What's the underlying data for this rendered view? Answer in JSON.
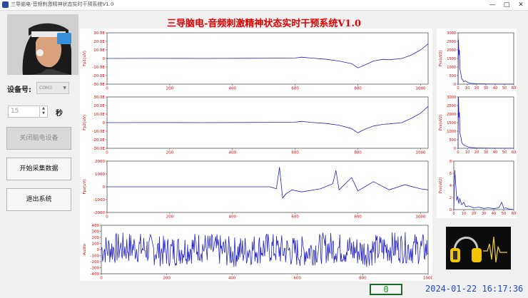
{
  "window": {
    "title": "三导脑电-音频刺激精神状态实时干预系统V1.0",
    "controls": [
      "—",
      "□",
      "✕"
    ]
  },
  "app": {
    "title": "三导脑电-音频刺激精神状态实时干预系统V1.0"
  },
  "sidebar": {
    "device_label": "设备号:",
    "device_value": "COM3",
    "seconds_value": "15",
    "seconds_unit": "秒",
    "buttons": [
      {
        "label": "关闭脑电设备",
        "enabled": false
      },
      {
        "label": "开始采集数据",
        "enabled": true
      },
      {
        "label": "退出系统",
        "enabled": true
      }
    ]
  },
  "status": {
    "counter": "0",
    "datetime": "2024-01-22 16:17:36"
  },
  "colors": {
    "trace": "#2323c8",
    "title": "#e00000",
    "clock": "#1d4bd0",
    "counter": "#1aa41a"
  },
  "chart_data": [
    {
      "type": "line",
      "ylabel": "Fp1(uV)",
      "x_ticks": [
        "0",
        "200",
        "400",
        "600",
        "800",
        "1000"
      ],
      "y_ticks": [
        "-30.0E",
        "-20.0E",
        "-10.0E",
        "0",
        "10.0E",
        "20.0E",
        "30.0E"
      ],
      "xlim": [
        0,
        1024
      ],
      "ylim": [
        -30,
        30
      ],
      "x": [
        0,
        150,
        300,
        450,
        600,
        620,
        650,
        700,
        740,
        780,
        800,
        820,
        850,
        880,
        900,
        940,
        970,
        1000,
        1024
      ],
      "y": [
        0,
        0.1,
        0,
        0.2,
        0.5,
        1.5,
        0.5,
        -1,
        -3,
        -6,
        -11,
        -8,
        -3,
        -1,
        -1.5,
        0,
        4,
        10,
        17
      ]
    },
    {
      "type": "line",
      "ylabel": "Fp2(uV)",
      "x_ticks": [
        "0",
        "200",
        "400",
        "600",
        "800",
        "1000"
      ],
      "y_ticks": [
        "-30.0E",
        "-20.0E",
        "-10.0E",
        "0",
        "10.0E",
        "20.0E",
        "30.0E"
      ],
      "xlim": [
        0,
        1024
      ],
      "ylim": [
        -30,
        30
      ],
      "x": [
        0,
        150,
        300,
        450,
        600,
        620,
        650,
        700,
        740,
        780,
        800,
        820,
        850,
        880,
        900,
        940,
        970,
        1000,
        1024
      ],
      "y": [
        0,
        0.1,
        0,
        0.2,
        0.5,
        1.5,
        0.3,
        -1,
        -3,
        -7,
        -12,
        -8,
        -4,
        -2,
        -1.5,
        0,
        5,
        11,
        19
      ]
    },
    {
      "type": "line",
      "ylabel": "Fpz(uV)",
      "x_ticks": [
        "0",
        "200",
        "400",
        "600",
        "800",
        "1000"
      ],
      "y_ticks": [
        "-2000",
        "-1000",
        "0",
        "1000",
        "2000"
      ],
      "xlim": [
        0,
        1024
      ],
      "ylim": [
        -2500,
        2500
      ],
      "x": [
        0,
        200,
        400,
        520,
        540,
        550,
        560,
        570,
        590,
        620,
        680,
        720,
        730,
        740,
        780,
        800,
        850,
        900,
        950,
        1000,
        1024
      ],
      "y": [
        0,
        0,
        0,
        0,
        -200,
        1900,
        -1100,
        -700,
        -300,
        -500,
        -200,
        300,
        1600,
        -300,
        900,
        -400,
        500,
        -300,
        200,
        -200,
        -300
      ]
    },
    {
      "type": "line",
      "ylabel": "Audio",
      "x_ticks": [
        "0",
        "200",
        "400",
        "600",
        "800",
        "1000"
      ],
      "y_ticks": [
        "-400",
        "-300",
        "-200",
        "-100",
        "0",
        "100",
        "200",
        "300",
        "400"
      ],
      "xlim": [
        0,
        1000
      ],
      "ylim": [
        -400,
        400
      ],
      "x": [
        0,
        100,
        200,
        300,
        400,
        500,
        600,
        700,
        800,
        900,
        1000
      ],
      "y": [
        0,
        250,
        -250,
        300,
        -300,
        200,
        -280,
        260,
        -240,
        280,
        0
      ]
    },
    {
      "type": "line",
      "ylabel": "Pxx(uV2)",
      "x_ticks": [
        "0",
        "10",
        "20",
        "30",
        "40",
        "50",
        "60"
      ],
      "y_ticks": [
        "0",
        "500",
        "1000",
        "1500",
        "2000",
        "2500",
        "3000"
      ],
      "xlim": [
        0,
        60
      ],
      "ylim": [
        0,
        3000
      ],
      "x": [
        0,
        0.5,
        1,
        1.5,
        2,
        3,
        4,
        5,
        6,
        8,
        10,
        12,
        15,
        20,
        30,
        40,
        50,
        60
      ],
      "y": [
        0,
        2600,
        1700,
        2000,
        900,
        600,
        300,
        250,
        150,
        180,
        120,
        60,
        40,
        20,
        10,
        5,
        3,
        0
      ]
    },
    {
      "type": "line",
      "ylabel": "Pxx(uV2)",
      "x_ticks": [
        "0",
        "10",
        "20",
        "30",
        "40",
        "50",
        "60"
      ],
      "y_ticks": [
        "0",
        "500",
        "1000",
        "1500",
        "2000",
        "2500",
        "3000"
      ],
      "xlim": [
        0,
        60
      ],
      "ylim": [
        0,
        3000
      ],
      "x": [
        0,
        0.5,
        1,
        1.5,
        2,
        3,
        4,
        5,
        6,
        8,
        10,
        12,
        15,
        20,
        30,
        40,
        50,
        60
      ],
      "y": [
        0,
        3000,
        1800,
        2100,
        900,
        650,
        350,
        250,
        200,
        150,
        100,
        60,
        40,
        20,
        10,
        5,
        3,
        0
      ]
    },
    {
      "type": "line",
      "ylabel": "Pxx(uV2)",
      "x_ticks": [
        "0",
        "10",
        "20",
        "30",
        "40",
        "50",
        "60"
      ],
      "y_ticks": [
        "0",
        "2",
        "4",
        "6",
        "8"
      ],
      "xlim": [
        0,
        60
      ],
      "ylim": [
        0,
        8
      ],
      "x": [
        0,
        1,
        2,
        3,
        4,
        5,
        6,
        8,
        10,
        12,
        15,
        20,
        25,
        30,
        35,
        40,
        45,
        48,
        50,
        52,
        55,
        60
      ],
      "y": [
        0,
        6.5,
        4,
        1.5,
        2.2,
        1,
        1.8,
        0.8,
        1.2,
        0.5,
        0.6,
        0.3,
        0.4,
        0.2,
        0.3,
        0.15,
        0.3,
        1.2,
        0.2,
        0.3,
        0.1,
        0
      ]
    }
  ]
}
